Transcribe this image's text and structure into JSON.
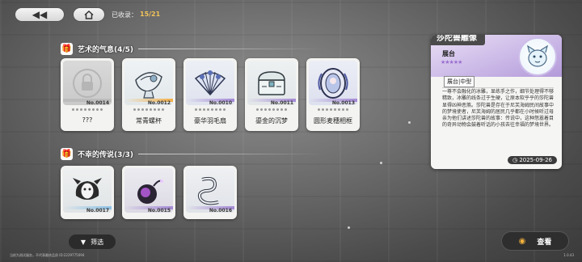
{
  "topbar": {
    "back_icon": "double-left-arrow-icon",
    "home_icon": "home-icon",
    "collected_label": "已收录：",
    "collected_count": "15/21"
  },
  "sections": [
    {
      "title": "艺术的气息(4/5)",
      "cards": [
        {
          "no": "No.0014",
          "name": "???",
          "rarity_color": "#bcbcbc",
          "locked": true
        },
        {
          "no": "No.0012",
          "name": "常青螺杯",
          "rarity_color": "#f3b04a"
        },
        {
          "no": "No.0010",
          "name": "豪华羽毛扇",
          "rarity_color": "#a58ad6"
        },
        {
          "no": "No.0011",
          "name": "鎏金的沉梦",
          "rarity_color": "#a58ad6"
        },
        {
          "no": "No.0013",
          "name": "圆形麦穗相框",
          "rarity_color": "#a58ad6"
        }
      ]
    },
    {
      "title": "不幸的传说(3/3)",
      "cards": [
        {
          "no": "No.0017",
          "name": "",
          "rarity_color": "#8fc2e6"
        },
        {
          "no": "No.0015",
          "name": "",
          "rarity_color": "#a58ad6"
        },
        {
          "no": "No.0016",
          "name": "",
          "rarity_color": "#a58ad6"
        }
      ]
    }
  ],
  "panel": {
    "title": "莎陀兽雕像",
    "subtitle": "展台",
    "stars": "★★★★★",
    "tag": "展台|中型",
    "description": "一尊不会融化的冰雕，显练手之作，细节处理得不够精致，冰雕的线条过于生硬，让原本软乎乎的莎陀兽显得凶神恶煞。莎陀兽是存在于尼芙海姆民间故事中的梦境使者，尼芙海姆的居民几乎都在小时候听过母亲为他们讲述莎陀兽的故事：传说中，这种怒嚣着目的奇异动物会鼓着听话的小孩去往幸福的梦境世界。",
    "date": "2025-09-26",
    "date_icon": "clock-icon"
  },
  "bottom": {
    "filter_label": "筛选",
    "view_label": "查看",
    "uid_text": "当前为测试服务，不代表最终品质 ID:2229775094",
    "version": "1.0.43"
  },
  "colors": {
    "accent_gold": "#f0c25a",
    "panel_purple": "#b39ad9"
  }
}
